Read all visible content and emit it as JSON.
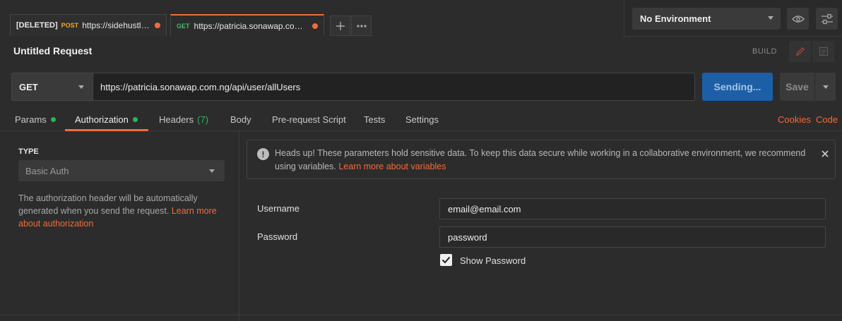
{
  "tabs": [
    {
      "prefix": "[DELETED]",
      "method": "POST",
      "url": "https://sidehustle.n...",
      "unsaved": true
    },
    {
      "prefix": "",
      "method": "GET",
      "url": "https://patricia.sonawap.com.n...",
      "unsaved": true
    }
  ],
  "tab_actions": {
    "add_icon": "plus-icon",
    "more_icon": "ellipsis-icon"
  },
  "environment": {
    "selected": "No Environment",
    "eye_icon": "eye-icon",
    "settings_icon": "sliders-icon"
  },
  "request": {
    "title": "Untitled Request",
    "mode_label": "BUILD",
    "method": "GET",
    "url": "https://patricia.sonawap.com.ng/api/user/allUsers",
    "send_label": "Sending...",
    "save_label": "Save"
  },
  "subtabs": {
    "params": "Params",
    "authorization": "Authorization",
    "headers": "Headers",
    "headers_count": "(7)",
    "body": "Body",
    "prerequest": "Pre-request Script",
    "tests": "Tests",
    "settings": "Settings",
    "cookies": "Cookies",
    "code": "Code"
  },
  "auth": {
    "type_label": "TYPE",
    "type_value": "Basic Auth",
    "description": "The authorization header will be automatically generated when you send the request. ",
    "learn_more": "Learn more about authorization"
  },
  "warning": {
    "text": "Heads up! These parameters hold sensitive data. To keep this data secure while working in a collaborative environment, we recommend using variables. ",
    "link": "Learn more about variables"
  },
  "credentials": {
    "username_label": "Username",
    "username_value": "email@email.com",
    "password_label": "Password",
    "password_value": "password",
    "show_password_label": "Show Password",
    "show_password_checked": true
  },
  "colors": {
    "accent": "#f26b3a",
    "send": "#1c5fa6",
    "ok": "#26b85a",
    "post": "#f5a623"
  }
}
